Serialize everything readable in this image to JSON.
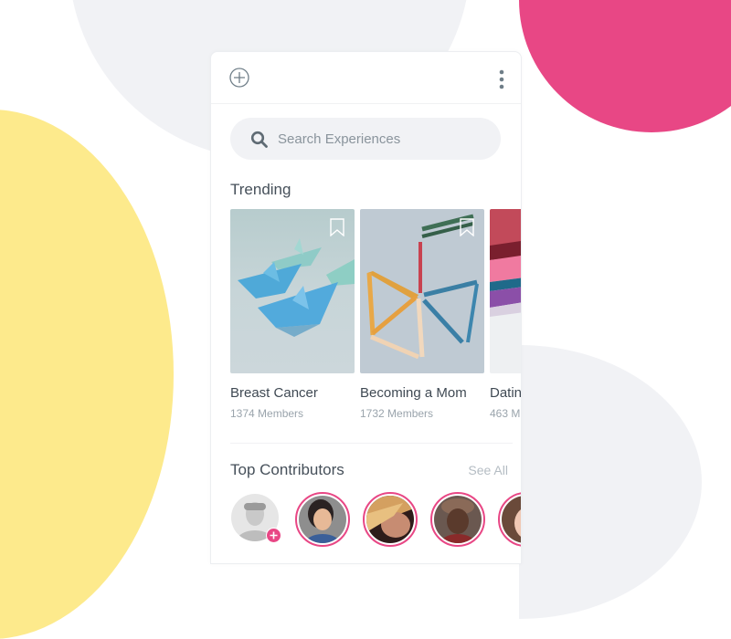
{
  "colors": {
    "accent": "#e84785",
    "yellow": "#fdea8c",
    "soft_gray": "#f1f2f5",
    "icon": "#6f7e88"
  },
  "header": {
    "add_icon": "plus-circle-icon",
    "more_icon": "more-vertical-icon"
  },
  "search": {
    "placeholder": "Search Experiences",
    "value": ""
  },
  "trending": {
    "title": "Trending",
    "items": [
      {
        "name": "Breast Cancer",
        "members": "1374 Members",
        "image": "paper-boats-photo",
        "bookmark_icon": "bookmark-icon"
      },
      {
        "name": "Becoming a Mom",
        "members": "1732 Members",
        "image": "colored-sticks-photo",
        "bookmark_icon": "bookmark-icon"
      },
      {
        "name": "Datin",
        "members": "463 M",
        "image": "pink-purple-abstract-photo",
        "bookmark_icon": "bookmark-icon"
      }
    ]
  },
  "contributors": {
    "title": "Top Contributors",
    "see_all": "See All",
    "avatars": [
      {
        "kind": "add",
        "badge": "plus-icon"
      },
      {
        "kind": "user",
        "ring": true
      },
      {
        "kind": "user",
        "ring": true
      },
      {
        "kind": "user",
        "ring": true
      },
      {
        "kind": "user",
        "ring": true
      }
    ]
  }
}
